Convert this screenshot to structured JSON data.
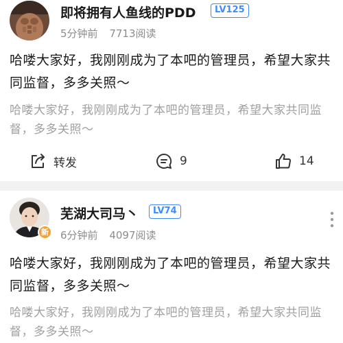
{
  "colors": {
    "level_badge": "#3d8bff",
    "meta_text": "#8c8c8c",
    "quote_text": "#a0a0a0",
    "new_badge": "#f0a23a"
  },
  "posts": [
    {
      "username": "即将拥有人鱼线的PDD",
      "level": "LV125",
      "time": "5分钟前",
      "views": "7713阅读",
      "content": "哈喽大家好，我刚刚成为了本吧的管理员，希望大家共同监督，多多关照～",
      "quote": "哈喽大家好，我刚刚成为了本吧的管理员，希望大家共同监督，多多关照～",
      "actions": {
        "share_label": "转发",
        "comment_count": "9",
        "like_count": "14",
        "share_icon": "share-icon",
        "comment_icon": "comment-icon",
        "like_icon": "thumbs-up-icon"
      }
    },
    {
      "username": "芜湖大司马丶",
      "level": "LV74",
      "time": "6分钟前",
      "views": "4097阅读",
      "new_badge": "新",
      "content": "哈喽大家好，我刚刚成为了本吧的管理员，希望大家共同监督，多多关照～",
      "quote": "哈喽大家好，我刚刚成为了本吧的管理员，希望大家共同监督，多多关照～"
    }
  ]
}
